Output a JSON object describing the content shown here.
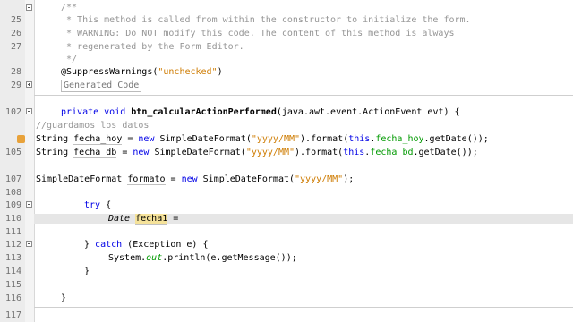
{
  "editor": {
    "lines": {
      "n25": "25",
      "n26": "26",
      "n27": "27",
      "n28": "28",
      "n29": "29",
      "n102": "102",
      "n105": "105",
      "n107": "107",
      "n108": "108",
      "n109": "109",
      "n110": "110",
      "n111": "111",
      "n112": "112",
      "n113": "113",
      "n114": "114",
      "n115": "115",
      "n116": "116",
      "n117": "117"
    },
    "code": {
      "l0": "/**",
      "l1": " * This method is called from within the constructor to initialize the form.",
      "l2": " * WARNING: Do NOT modify this code. The content of this method is always",
      "l3": " * regenerated by the Form Editor.",
      "l4": " */",
      "ann": "@SuppressWarnings(",
      "ann_str": "\"unchecked\"",
      "ann_close": ")",
      "generated": "Generated Code",
      "l102_kw": "private void ",
      "l102_m": "btn_calcularActionPerformed",
      "l102_rest": "(java.awt.event.ActionEvent evt) {",
      "comment": "//guardamos los datos",
      "l104_t": "String ",
      "l104_v": "fecha_hoy",
      "l104_eq": " = ",
      "l104_new": "new",
      "l104_cls": " SimpleDateFormat(",
      "l104_str": "\"yyyy/MM\"",
      "l104_mid": ").format(",
      "l104_this": "this",
      "l104_dot": ".",
      "l104_fld": "fecha_hoy",
      "l104_end": ".getDate());",
      "l105_t": "String ",
      "l105_v": "fecha_db",
      "l105_eq": " = ",
      "l105_new": "new",
      "l105_cls": " SimpleDateFormat(",
      "l105_str": "\"yyyy/MM\"",
      "l105_mid": ").format(",
      "l105_this": "this",
      "l105_dot": ".",
      "l105_fld": "fecha_bd",
      "l105_end": ".getDate());",
      "l107_t": "SimpleDateFormat ",
      "l107_v": "formato",
      "l107_eq": " = ",
      "l107_new": "new",
      "l107_cls": " SimpleDateFormat(",
      "l107_str": "\"yyyy/MM\"",
      "l107_end": ");",
      "try": "try",
      "try_brace": " {",
      "l110_t": "Date",
      "l110_sp": " ",
      "l110_v": "fecha1",
      "l110_eq": " = ",
      "l112_close": "} ",
      "catch": "catch",
      "l112_rest": " (Exception e) {",
      "l113_a": "System.",
      "l113_out": "out",
      "l113_b": ".println(e.getMessage());",
      "l114": "}",
      "l116": "}"
    }
  }
}
